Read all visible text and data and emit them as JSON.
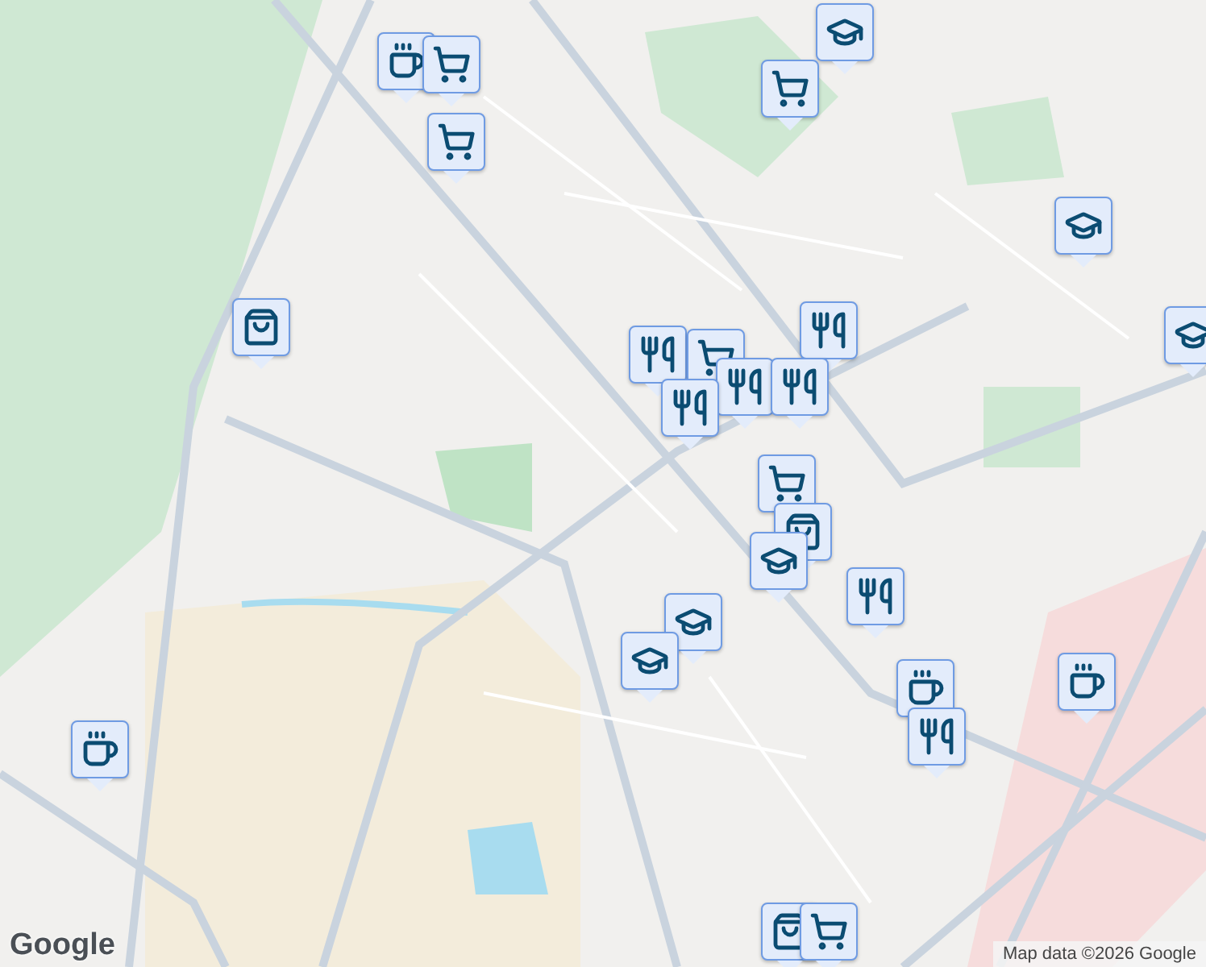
{
  "map": {
    "markers": [
      {
        "kind": "school"
      },
      {
        "kind": "cafe"
      },
      {
        "kind": "grocery"
      },
      {
        "kind": "grocery"
      },
      {
        "kind": "grocery"
      },
      {
        "kind": "school"
      },
      {
        "kind": "shopping"
      },
      {
        "kind": "school"
      },
      {
        "kind": "restaurant"
      },
      {
        "kind": "restaurant"
      },
      {
        "kind": "grocery"
      },
      {
        "kind": "restaurant"
      },
      {
        "kind": "restaurant"
      },
      {
        "kind": "restaurant"
      },
      {
        "kind": "grocery"
      },
      {
        "kind": "shopping"
      },
      {
        "kind": "school"
      },
      {
        "kind": "restaurant"
      },
      {
        "kind": "school"
      },
      {
        "kind": "school"
      },
      {
        "kind": "cafe"
      },
      {
        "kind": "cafe"
      },
      {
        "kind": "restaurant"
      },
      {
        "kind": "cafe"
      },
      {
        "kind": "shopping"
      },
      {
        "kind": "grocery"
      }
    ],
    "logo": "Google",
    "attribution": "Map data ©2026 Google"
  }
}
